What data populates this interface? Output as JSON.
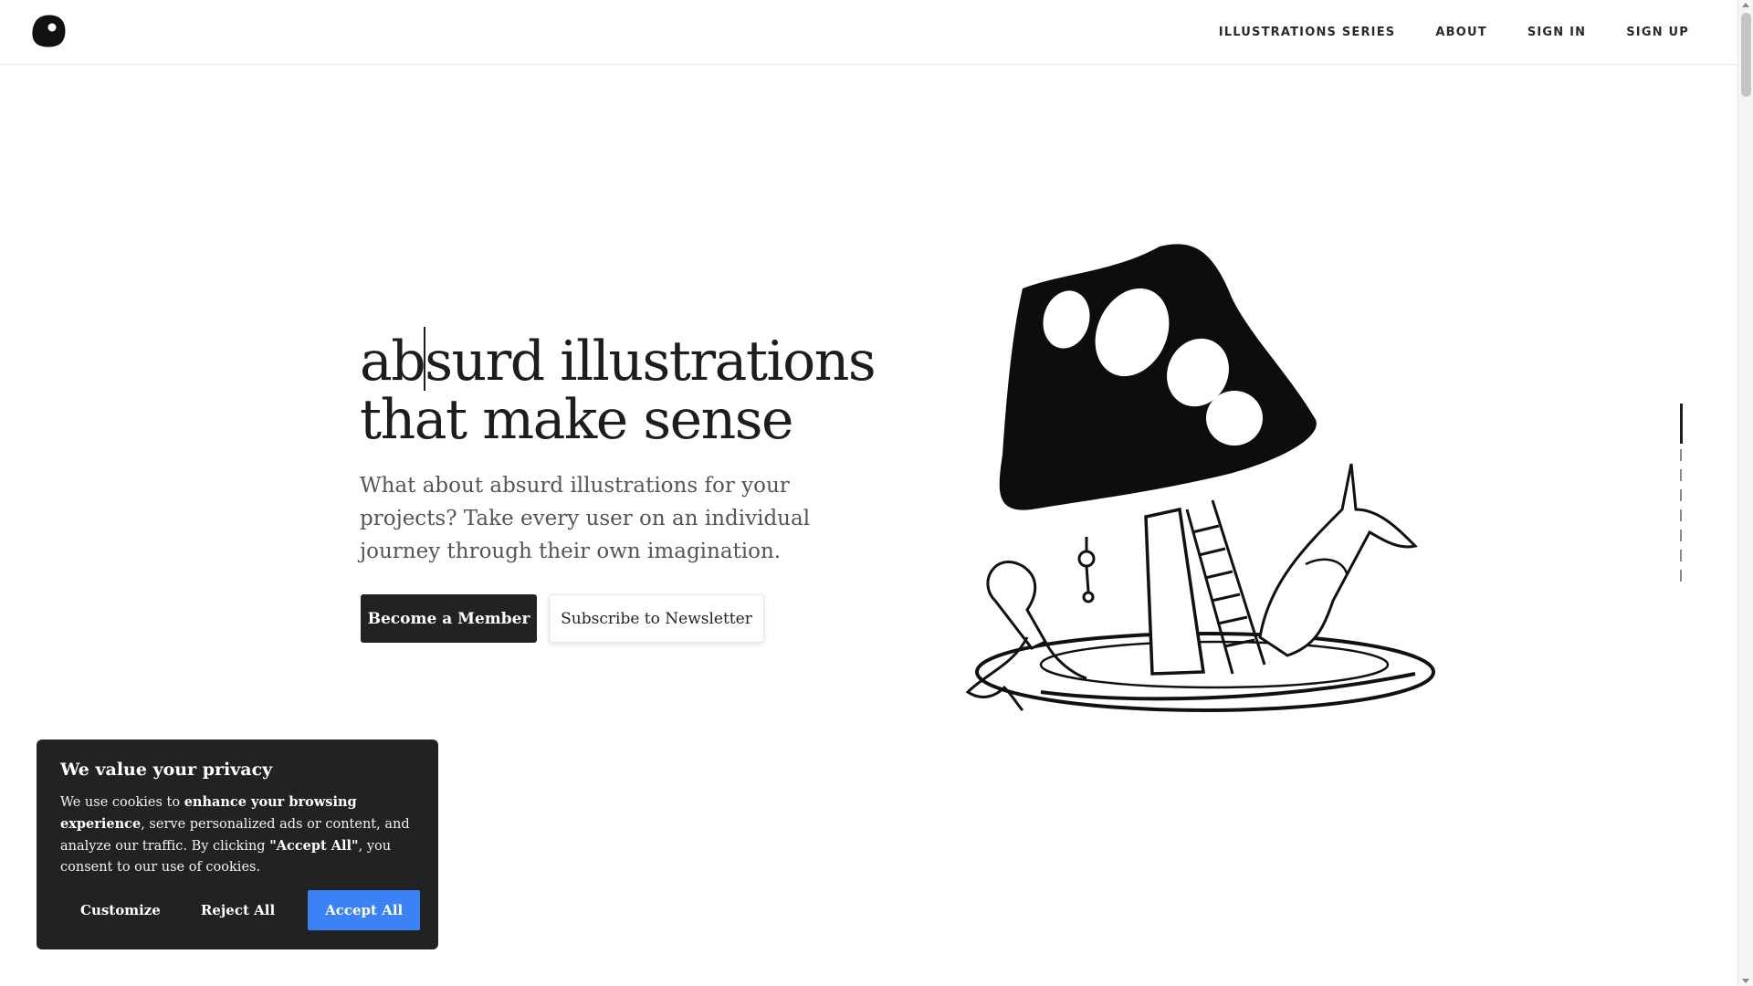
{
  "header": {
    "logo_icon": "blob-logo-icon",
    "nav": [
      {
        "label": "ILLUSTRATIONS SERIES"
      },
      {
        "label": "ABOUT"
      },
      {
        "label": "SIGN IN"
      },
      {
        "label": "SIGN UP"
      }
    ]
  },
  "hero": {
    "title_part1": "ab",
    "title_part2": "surd illustrations",
    "title_line2": "that make sense",
    "subtitle": "What about absurd illustrations for your projects? Take every user on an individual journey through their own imagination.",
    "primary_button": "Become a Member",
    "secondary_button": "Subscribe to Newsletter",
    "illustration_icon": "mushroom-lamp-illustration"
  },
  "cookie": {
    "title": "We value your privacy",
    "text_1": "We use cookies to ",
    "text_bold_1": "enhance your browsing experience",
    "text_2": ", serve personalized ads or content, and analyze our traffic. By clicking ",
    "text_bold_2": "\"Accept All\"",
    "text_3": ", you consent to our use of cookies.",
    "customize": "Customize",
    "reject": "Reject All",
    "accept": "Accept All",
    "accept_color": "#3b82f6"
  }
}
